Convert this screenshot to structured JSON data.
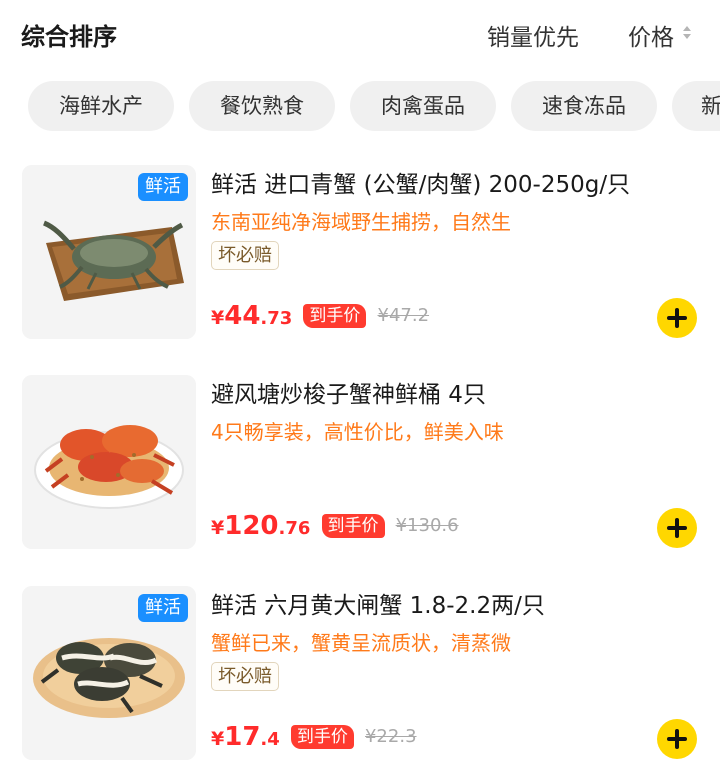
{
  "sort": {
    "title": "综合排序",
    "sales_label": "销量优先",
    "price_label": "价格"
  },
  "categories": [
    "海鲜水产",
    "餐饮熟食",
    "肉禽蛋品",
    "速食冻品",
    "新"
  ],
  "products": [
    {
      "badge": "鲜活",
      "title": "鲜活 进口青蟹 (公蟹/肉蟹) 200-250g/只",
      "subtitle": "东南亚纯净海域野生捕捞，自然生",
      "tag": "坏必赔",
      "currency": "¥",
      "price_int": "44",
      "price_dec": ".73",
      "price_label": "到手价",
      "original_price": "¥47.2",
      "image_icon": "green-crab-on-wooden-board"
    },
    {
      "badge": "",
      "title": "避风塘炒梭子蟹神鲜桶 4只",
      "subtitle": "4只畅享装，高性价比，鲜美入味",
      "tag": "",
      "currency": "¥",
      "price_int": "120",
      "price_dec": ".76",
      "price_label": "到手价",
      "original_price": "¥130.6",
      "image_icon": "fried-crabs-on-plate"
    },
    {
      "badge": "鲜活",
      "title": "鲜活 六月黄大闸蟹 1.8-2.2两/只",
      "subtitle": "蟹鲜已来，蟹黄呈流质状，清蒸微",
      "tag": "坏必赔",
      "currency": "¥",
      "price_int": "17",
      "price_dec": ".4",
      "price_label": "到手价",
      "original_price": "¥22.3",
      "image_icon": "tied-hairy-crabs-on-plate"
    }
  ],
  "colors": {
    "price_red": "#ff2b2b",
    "subtitle_orange": "#ff7a1a",
    "badge_blue": "#1a8fff",
    "add_yellow": "#ffd700"
  }
}
